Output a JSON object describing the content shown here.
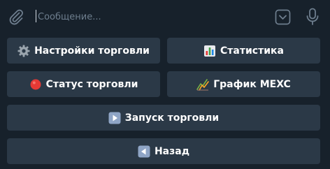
{
  "composer": {
    "placeholder": "Сообщение...",
    "attach_icon": "paperclip-icon",
    "keyboard_icon": "keyboard-toggle-icon",
    "mic_icon": "microphone-icon"
  },
  "keyboard": {
    "rows": [
      [
        {
          "emoji": "gear-icon",
          "label": "Настройки торговли"
        },
        {
          "emoji": "bar-chart-icon",
          "label": "Статистика"
        }
      ],
      [
        {
          "emoji": "red-circle-icon",
          "label": "Статус торговли"
        },
        {
          "emoji": "trend-chart-icon",
          "label": "График MEXC"
        }
      ],
      [
        {
          "emoji": "play-icon",
          "label": "Запуск торговли"
        }
      ],
      [
        {
          "emoji": "back-arrow-icon",
          "label": "Назад"
        }
      ]
    ]
  },
  "colors": {
    "background": "#17212b",
    "button_bg": "#2b3947",
    "text": "#ffffff",
    "icon": "#6e7e8e"
  }
}
